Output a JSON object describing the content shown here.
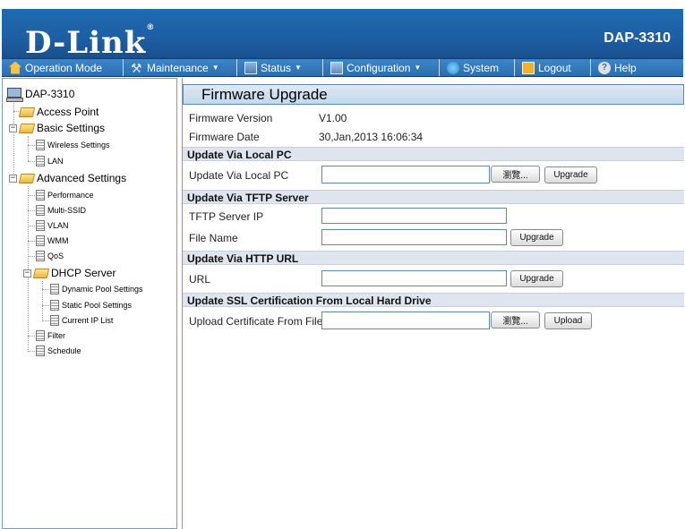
{
  "header": {
    "logo": "D-Link",
    "logo_mark": "®",
    "model": "DAP-3310"
  },
  "menu": [
    {
      "label": "Operation Mode",
      "icon": "home-icon",
      "dropdown": false
    },
    {
      "label": "Maintenance",
      "icon": "tools-icon",
      "dropdown": true
    },
    {
      "label": "Status",
      "icon": "status-icon",
      "dropdown": true
    },
    {
      "label": "Configuration",
      "icon": "configuration-icon",
      "dropdown": true
    },
    {
      "label": "System",
      "icon": "system-icon",
      "dropdown": false
    },
    {
      "label": "Logout",
      "icon": "logout-icon",
      "dropdown": false
    },
    {
      "label": "Help",
      "icon": "help-icon",
      "dropdown": false
    }
  ],
  "sidebar": {
    "root": "DAP-3310",
    "access_point": "Access Point",
    "basic_settings": "Basic Settings",
    "wireless_settings": "Wireless Settings",
    "lan": "LAN",
    "advanced_settings": "Advanced Settings",
    "performance": "Performance",
    "multi_ssid": "Multi-SSID",
    "vlan": "VLAN",
    "wmm": "WMM",
    "qos": "QoS",
    "dhcp_server": "DHCP Server",
    "dynamic_pool": "Dynamic Pool Settings",
    "static_pool": "Static Pool Settings",
    "current_ip": "Current IP List",
    "filter": "Filter",
    "schedule": "Schedule"
  },
  "page": {
    "title": "Firmware Upgrade",
    "firmware_version_label": "Firmware Version",
    "firmware_version": "V1.00",
    "firmware_date_label": "Firmware Date",
    "firmware_date": "30,Jan,2013 16:06:34",
    "local_pc": {
      "section": "Update Via Local PC",
      "label": "Update Via Local PC",
      "browse": "瀏覽...",
      "upgrade": "Upgrade",
      "value": ""
    },
    "tftp": {
      "section": "Update Via TFTP Server",
      "server_ip_label": "TFTP Server IP",
      "server_ip": "",
      "file_name_label": "File Name",
      "file_name": "",
      "upgrade": "Upgrade"
    },
    "http": {
      "section": "Update Via HTTP URL",
      "url_label": "URL",
      "url": "",
      "upgrade": "Upgrade"
    },
    "ssl": {
      "section": "Update SSL Certification From Local Hard Drive",
      "label": "Upload Certificate From File",
      "browse": "瀏覽...",
      "upload": "Upload",
      "value": ""
    }
  }
}
